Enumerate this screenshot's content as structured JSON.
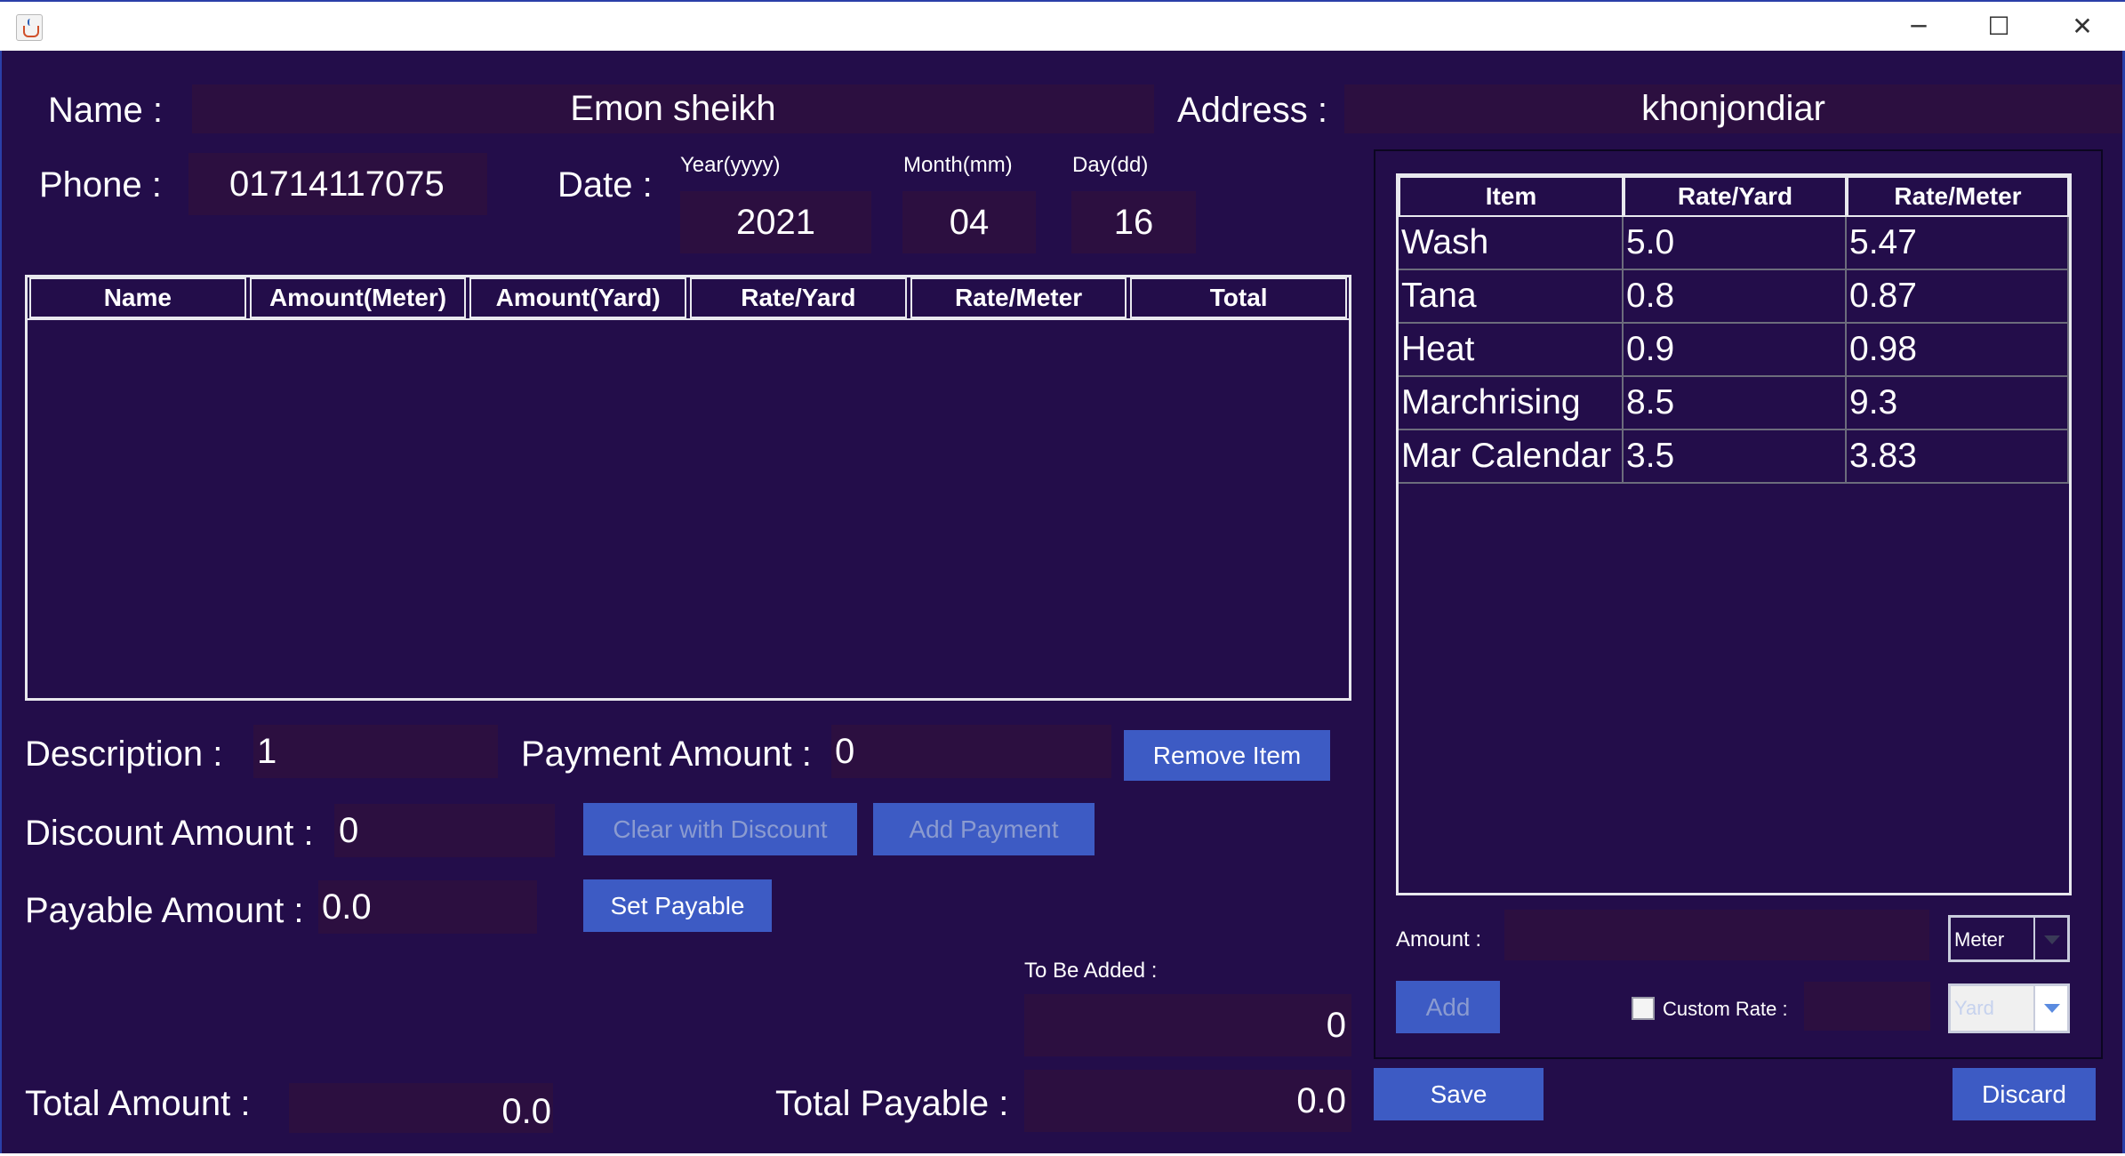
{
  "window": {
    "icon": "java-cup-icon",
    "minimize_glyph": "─",
    "maximize_glyph": "☐",
    "close_glyph": "✕"
  },
  "customer": {
    "name_label": "Name :",
    "name_value": "Emon sheikh",
    "address_label": "Address :",
    "address_value": "khonjondiar",
    "phone_label": "Phone :",
    "phone_value": "01714117075",
    "date_label": "Date :",
    "year_label": "Year(yyyy)",
    "year_value": "2021",
    "month_label": "Month(mm)",
    "month_value": "04",
    "day_label": "Day(dd)",
    "day_value": "16"
  },
  "bill_table": {
    "columns": [
      "Name",
      "Amount(Meter)",
      "Amount(Yard)",
      "Rate/Yard",
      "Rate/Meter",
      "Total"
    ],
    "rows": []
  },
  "controls": {
    "description_label": "Description :",
    "description_value": "1",
    "payment_amount_label": "Payment Amount :",
    "payment_amount_value": "0",
    "remove_item_button": "Remove Item",
    "discount_amount_label": "Discount Amount :",
    "discount_amount_value": "0",
    "clear_with_discount_button": "Clear with Discount",
    "add_payment_button": "Add Payment",
    "payable_amount_label": "Payable Amount :",
    "payable_amount_value": "0.0",
    "set_payable_button": "Set Payable",
    "to_be_added_label": "To Be Added :",
    "to_be_added_value": "0",
    "total_amount_label": "Total Amount :",
    "total_amount_value": "0.0",
    "total_payable_label": "Total Payable :",
    "total_payable_value": "0.0",
    "save_button": "Save",
    "discard_button": "Discard"
  },
  "rate_table": {
    "columns": [
      "Item",
      "Rate/Yard",
      "Rate/Meter"
    ],
    "rows": [
      [
        "Wash",
        "5.0",
        "5.47"
      ],
      [
        "Tana",
        "0.8",
        "0.87"
      ],
      [
        "Heat",
        "0.9",
        "0.98"
      ],
      [
        "Marchrising",
        "8.5",
        "9.3"
      ],
      [
        "Mar Calendar",
        "3.5",
        "3.83"
      ]
    ]
  },
  "rate_controls": {
    "amount_label": "Amount :",
    "amount_value": "",
    "unit_selected": "Meter",
    "add_button": "Add",
    "custom_rate_label": "Custom Rate :",
    "custom_rate_checked": false,
    "custom_rate_value": "",
    "custom_unit_selected": "Yard"
  },
  "colors": {
    "background": "#230d4a",
    "field": "#2c0f40",
    "button": "#3d5bc4",
    "border": "#2a3fa8"
  }
}
